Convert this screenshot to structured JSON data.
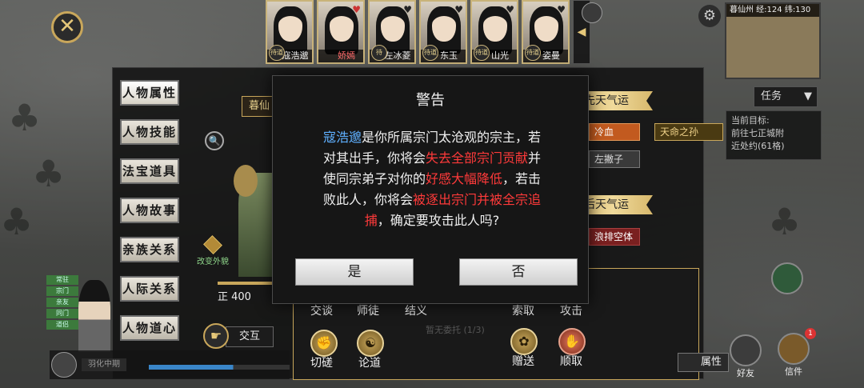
{
  "close_icon": "close-icon",
  "portraits": [
    {
      "tag": "待道",
      "name": "寇浩邈",
      "red": false,
      "heart": false
    },
    {
      "tag": "",
      "name": "娇嫣",
      "red": true,
      "heart": true
    },
    {
      "tag": "待",
      "name": "左冰菱",
      "red": false,
      "heart": true
    },
    {
      "tag": "待道",
      "name": "东玉",
      "red": false,
      "heart": true
    },
    {
      "tag": "待道",
      "name": "山光",
      "red": false,
      "heart": true
    },
    {
      "tag": "待道",
      "name": "姿曼",
      "red": false,
      "heart": true
    }
  ],
  "minimap": {
    "title": "暮仙州 经:124 纬:130"
  },
  "task": {
    "header": "任务",
    "lines": [
      "当前目标:",
      "前往七正城附",
      "近处约(61格)"
    ]
  },
  "side_tabs": [
    "人物属性",
    "人物技能",
    "法宝道具",
    "人物故事",
    "亲族关系",
    "人际关系",
    "人物道心"
  ],
  "realm_tag": "暮仙",
  "change_look": "改变外貌",
  "stat": "正 400",
  "interact": "交互",
  "luck": {
    "innate_title": "先天气运",
    "innate": [
      "冷血",
      "天命之孙",
      "左撇子"
    ],
    "acquired_title": "后天气运",
    "acquired": [
      "浪排空体"
    ]
  },
  "roster_tags": [
    "常驻",
    "宗门",
    "亲友",
    "同门",
    "道侣",
    "弟子"
  ],
  "roster_name": "羽化中期",
  "options": {
    "top": [
      "交谈",
      "师徒",
      "结义",
      "索取",
      "攻击"
    ],
    "bottom": [
      "切磋",
      "论道",
      "赠送",
      "顺取"
    ],
    "faded": "暂无委托 (1/3)"
  },
  "attr_button": "属性",
  "edge": {
    "mail": "信件",
    "friend": "好友",
    "badge": "1"
  },
  "dialog": {
    "title": "警告",
    "body": [
      {
        "t": "寇浩邈",
        "c": "blue"
      },
      {
        "t": "是你所属宗门太沧观的宗主，若对其出手，你将会",
        "c": ""
      },
      {
        "t": "失去全部宗门贡献",
        "c": "red"
      },
      {
        "t": "并使同宗弟子对你的",
        "c": ""
      },
      {
        "t": "好感大幅降低",
        "c": "red"
      },
      {
        "t": "，若击败此人，你将会",
        "c": ""
      },
      {
        "t": "被逐出宗门并被全宗追捕",
        "c": "red"
      },
      {
        "t": "，确定要攻击此人吗?",
        "c": ""
      }
    ],
    "yes": "是",
    "no": "否"
  }
}
